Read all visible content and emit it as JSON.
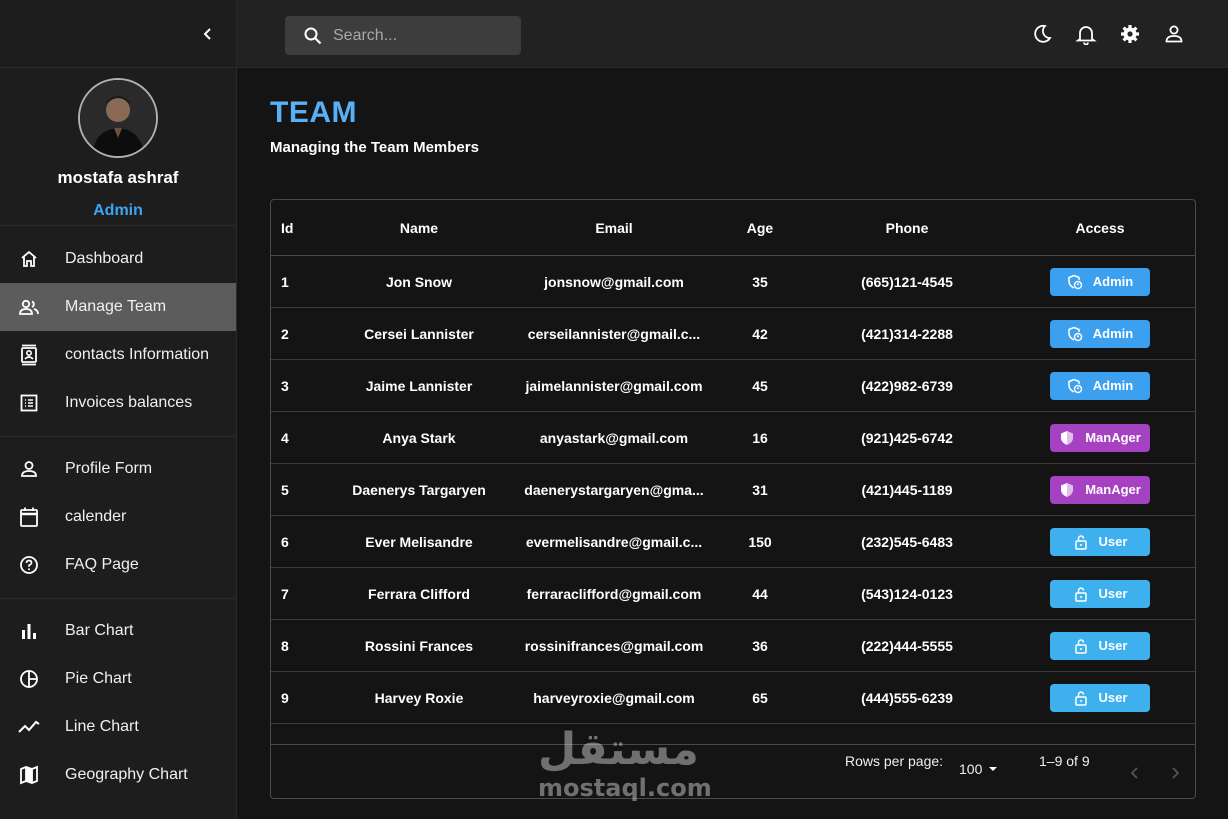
{
  "sidebar": {
    "profile": {
      "name": "mostafa ashraf",
      "role": "Admin"
    },
    "groups": [
      [
        {
          "label": "Dashboard",
          "icon": "home-icon",
          "active": false
        },
        {
          "label": "Manage Team",
          "icon": "people-icon",
          "active": true
        },
        {
          "label": "contacts Information",
          "icon": "contacts-icon",
          "active": false
        },
        {
          "label": "Invoices balances",
          "icon": "receipt-icon",
          "active": false
        }
      ],
      [
        {
          "label": "Profile Form",
          "icon": "person-icon",
          "active": false
        },
        {
          "label": "calender",
          "icon": "calendar-icon",
          "active": false
        },
        {
          "label": "FAQ Page",
          "icon": "help-circle-icon",
          "active": false
        }
      ],
      [
        {
          "label": "Bar Chart",
          "icon": "bar-chart-icon",
          "active": false
        },
        {
          "label": "Pie Chart",
          "icon": "pie-chart-icon",
          "active": false
        },
        {
          "label": "Line Chart",
          "icon": "line-chart-icon",
          "active": false
        },
        {
          "label": "Geography Chart",
          "icon": "map-icon",
          "active": false
        }
      ]
    ]
  },
  "topbar": {
    "search_placeholder": "Search...",
    "icons": [
      "dark-mode-icon",
      "notifications-icon",
      "settings-icon",
      "account-icon"
    ]
  },
  "page": {
    "title": "TEAM",
    "subtitle": "Managing the Team Members"
  },
  "table": {
    "columns": [
      "Id",
      "Name",
      "Email",
      "Age",
      "Phone",
      "Access"
    ],
    "rows": [
      {
        "id": "1",
        "name": "Jon Snow",
        "email": "jonsnow@gmail.com",
        "age": "35",
        "phone": "(665)121-4545",
        "access": "Admin"
      },
      {
        "id": "2",
        "name": "Cersei Lannister",
        "email": "cerseilannister@gmail.c...",
        "age": "42",
        "phone": "(421)314-2288",
        "access": "Admin"
      },
      {
        "id": "3",
        "name": "Jaime Lannister",
        "email": "jaimelannister@gmail.com",
        "age": "45",
        "phone": "(422)982-6739",
        "access": "Admin"
      },
      {
        "id": "4",
        "name": "Anya Stark",
        "email": "anyastark@gmail.com",
        "age": "16",
        "phone": "(921)425-6742",
        "access": "ManAger"
      },
      {
        "id": "5",
        "name": "Daenerys Targaryen",
        "email": "daenerystargaryen@gma...",
        "age": "31",
        "phone": "(421)445-1189",
        "access": "ManAger"
      },
      {
        "id": "6",
        "name": "Ever Melisandre",
        "email": "evermelisandre@gmail.c...",
        "age": "150",
        "phone": "(232)545-6483",
        "access": "User"
      },
      {
        "id": "7",
        "name": "Ferrara Clifford",
        "email": "ferraraclifford@gmail.com",
        "age": "44",
        "phone": "(543)124-0123",
        "access": "User"
      },
      {
        "id": "8",
        "name": "Rossini Frances",
        "email": "rossinifrances@gmail.com",
        "age": "36",
        "phone": "(222)444-5555",
        "access": "User"
      },
      {
        "id": "9",
        "name": "Harvey Roxie",
        "email": "harveyroxie@gmail.com",
        "age": "65",
        "phone": "(444)555-6239",
        "access": "User"
      }
    ]
  },
  "pagination": {
    "rows_per_page_label": "Rows per page:",
    "rows_per_page_value": "100",
    "range_label": "1–9 of 9"
  },
  "watermark": {
    "arabic": "مستقل",
    "latin": "mostaql.com"
  },
  "colors": {
    "accent": "#5ab0f5",
    "admin": "#3da0ef",
    "manager": "#a542c2",
    "user": "#3fb0ee",
    "active_nav": "#5c5c5c"
  }
}
